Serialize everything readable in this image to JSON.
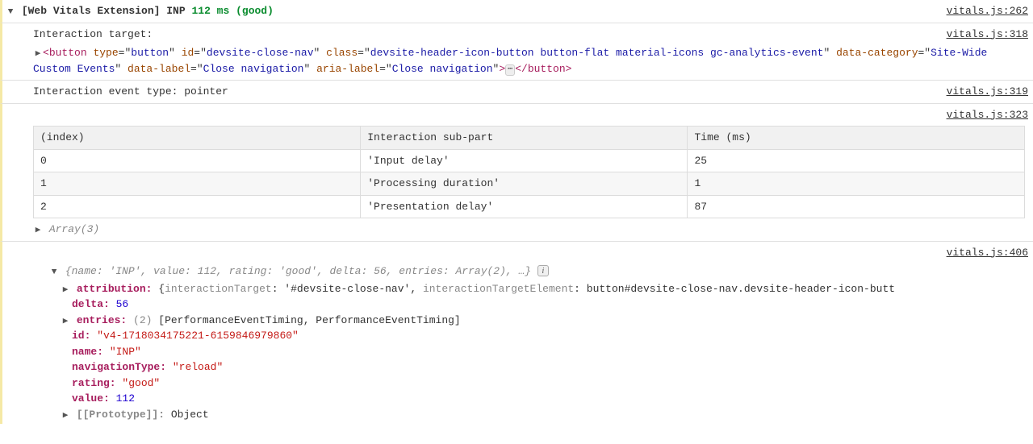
{
  "header": {
    "prefix": "[Web Vitals Extension] INP",
    "value": "112 ms",
    "rating": "(good)",
    "source": "vitals.js:262"
  },
  "target": {
    "label": "Interaction target:",
    "source": "vitals.js:318",
    "html_tag": "button",
    "attrs": {
      "type": {
        "n": "type",
        "v": "button"
      },
      "id": {
        "n": "id",
        "v": "devsite-close-nav"
      },
      "class": {
        "n": "class",
        "v": "devsite-header-icon-button button-flat material-icons gc-analytics-event"
      },
      "data_category": {
        "n": "data-category",
        "v": "Site-Wide Custom Events"
      },
      "data_label": {
        "n": "data-label",
        "v": "Close navigation"
      },
      "aria_label": {
        "n": "aria-label",
        "v": "Close navigation"
      }
    },
    "close_tag": "button"
  },
  "event_type": {
    "text": "Interaction event type: pointer",
    "source": "vitals.js:319"
  },
  "table": {
    "source": "vitals.js:323",
    "headers": {
      "c0": "(index)",
      "c1": "Interaction sub-part",
      "c2": "Time (ms)"
    },
    "rows": [
      {
        "idx": "0",
        "part": "'Input delay'",
        "time": "25"
      },
      {
        "idx": "1",
        "part": "'Processing duration'",
        "time": "1"
      },
      {
        "idx": "2",
        "part": "'Presentation delay'",
        "time": "87"
      }
    ],
    "array_label": "Array(3)"
  },
  "obj": {
    "source": "vitals.js:406",
    "preview": "{name: 'INP', value: 112, rating: 'good', delta: 56, entries: Array(2), …}",
    "attribution": {
      "key": "attribution:",
      "preview_open": "{",
      "k1": "interactionTarget",
      "v1": "'#devsite-close-nav'",
      "k2": "interactionTargetElement",
      "v2": "button#devsite-close-nav.devsite-header-icon-butt"
    },
    "delta": {
      "key": "delta:",
      "val": "56"
    },
    "entries": {
      "key": "entries:",
      "count": "(2)",
      "preview": "[PerformanceEventTiming, PerformanceEventTiming]"
    },
    "id": {
      "key": "id:",
      "val": "\"v4-1718034175221-6159846979860\""
    },
    "name": {
      "key": "name:",
      "val": "\"INP\""
    },
    "navType": {
      "key": "navigationType:",
      "val": "\"reload\""
    },
    "rating": {
      "key": "rating:",
      "val": "\"good\""
    },
    "value": {
      "key": "value:",
      "val": "112"
    },
    "proto": {
      "key": "[[Prototype]]:",
      "val": "Object"
    }
  }
}
